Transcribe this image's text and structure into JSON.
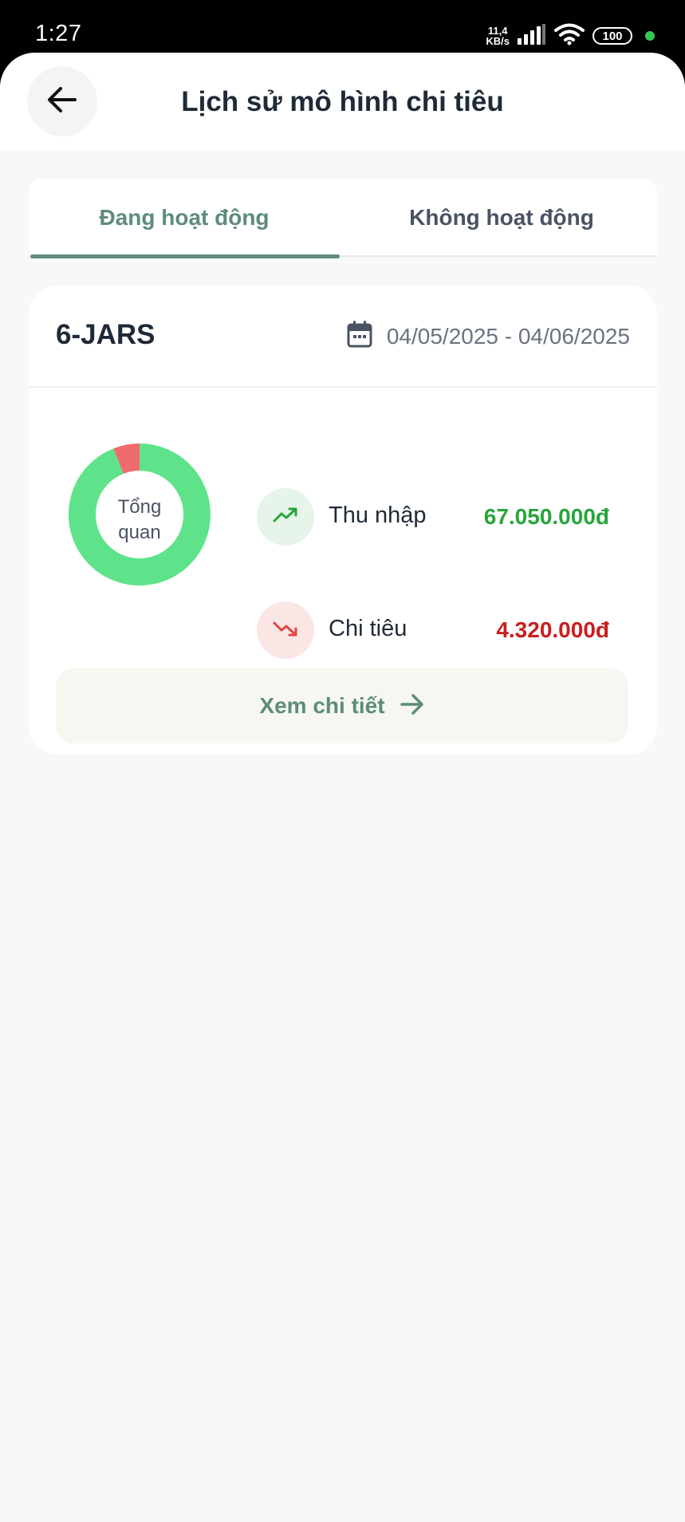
{
  "status_bar": {
    "time": "1:27",
    "net_speed_value": "11,4",
    "net_speed_unit": "KB/s",
    "battery": "100"
  },
  "header": {
    "title": "Lịch sử mô hình chi tiêu",
    "back_icon": "arrow-left-icon"
  },
  "tabs": [
    {
      "label": "Đang hoạt động",
      "active": true
    },
    {
      "label": "Không hoạt động",
      "active": false
    }
  ],
  "card": {
    "title": "6-JARS",
    "date_icon": "calendar-icon",
    "date_range": "04/05/2025 - 04/06/2025",
    "overview": {
      "label_line1": "Tổng",
      "label_line2": "quan",
      "income_share": 0.94,
      "expense_share": 0.06
    },
    "income": {
      "label": "Thu nhập",
      "value": "67.050.000đ",
      "icon": "trending-up-icon"
    },
    "expense": {
      "label": "Chi tiêu",
      "value": "4.320.000đ",
      "icon": "trending-down-icon"
    },
    "detail_button": {
      "label": "Xem chi tiết",
      "icon": "arrow-right-icon"
    }
  },
  "colors": {
    "accent": "#5d8c79",
    "income": "#27a63a",
    "expense": "#c81e1e",
    "donut_income": "#5fe38a",
    "donut_expense": "#f06b6b"
  }
}
